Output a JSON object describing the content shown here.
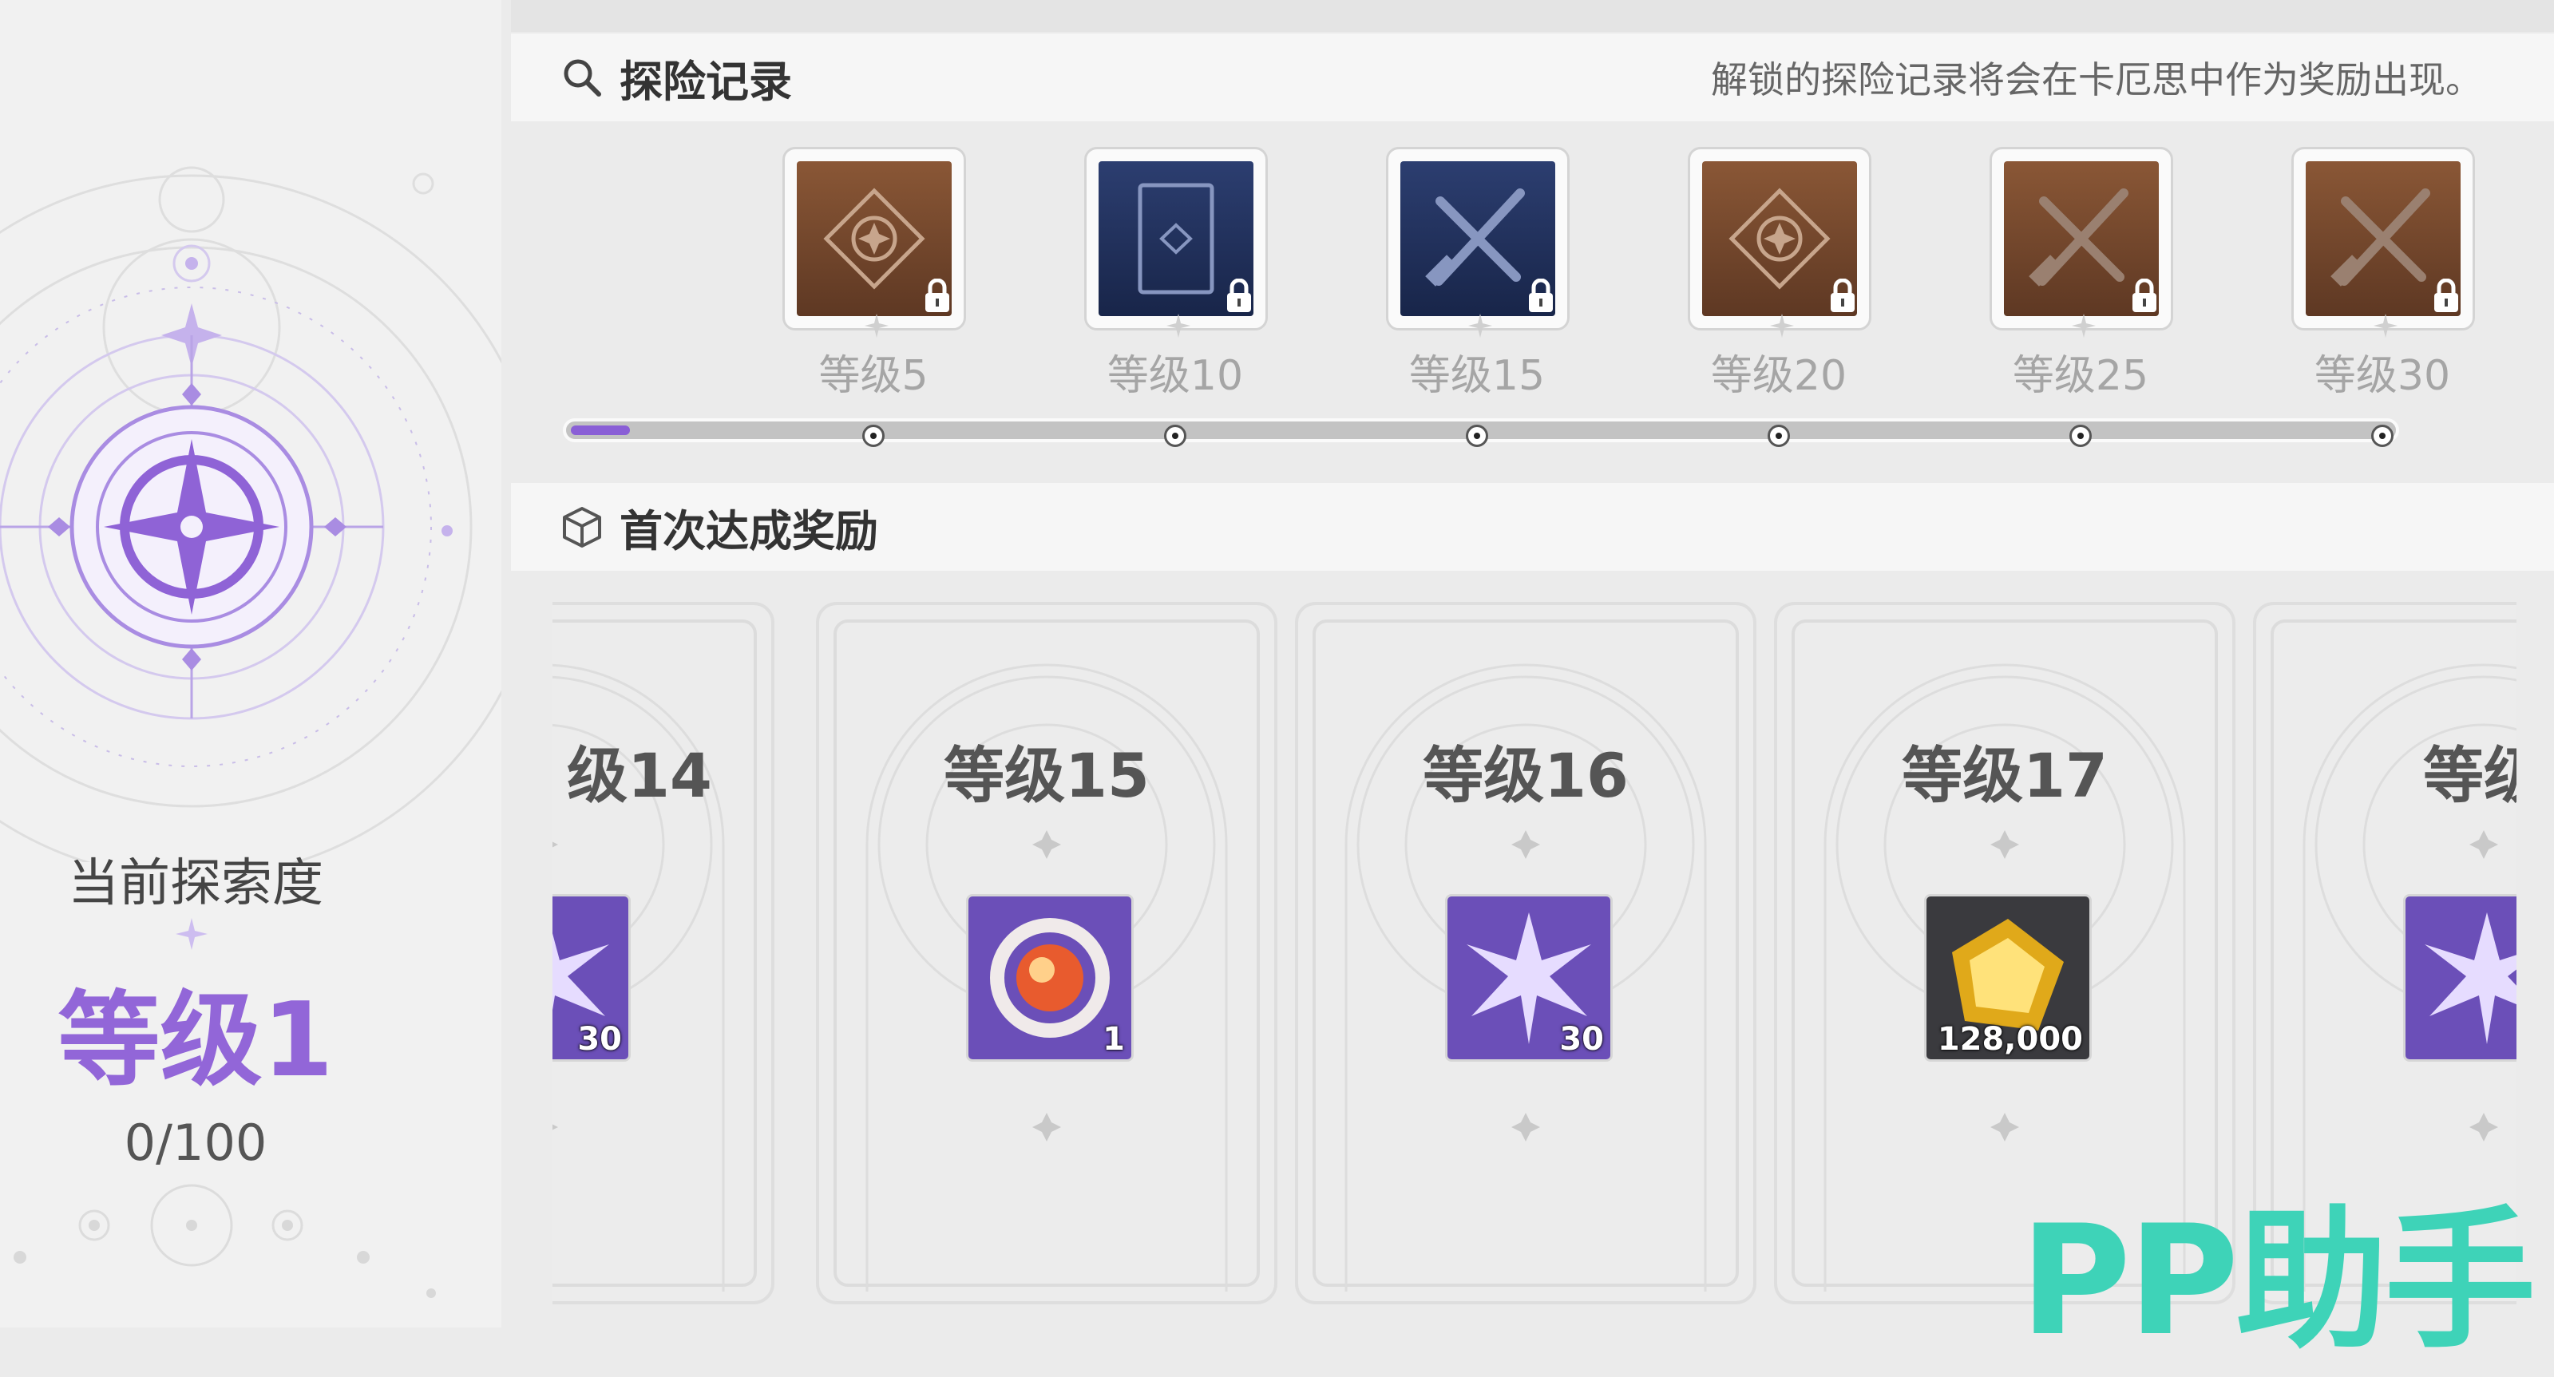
{
  "left_panel": {
    "current_label": "当前探索度",
    "level": "等级1",
    "progress": "0/100"
  },
  "records": {
    "title": "探险记录",
    "hint": "解锁的探险记录将会在卡厄思中作为奖励出现。",
    "items": [
      {
        "level": "等级5",
        "icon": "diamond-target-icon",
        "theme": "brown"
      },
      {
        "level": "等级10",
        "icon": "card-icon",
        "theme": "navy"
      },
      {
        "level": "等级15",
        "icon": "crossed-weapons-icon",
        "theme": "navy"
      },
      {
        "level": "等级20",
        "icon": "diamond-target-icon",
        "theme": "brown"
      },
      {
        "level": "等级25",
        "icon": "crossed-weapons-icon",
        "theme": "brown"
      },
      {
        "level": "等级30",
        "icon": "crossed-weapons-icon",
        "theme": "brown"
      }
    ],
    "progress_fraction": 0.02
  },
  "rewards": {
    "title": "首次达成奖励",
    "cards": [
      {
        "level": "级14",
        "item": "crystal-star-icon",
        "quantity": "30"
      },
      {
        "level": "等级15",
        "item": "orb-device-icon",
        "quantity": "1"
      },
      {
        "level": "等级16",
        "item": "crystal-star-icon",
        "quantity": "30"
      },
      {
        "level": "等级17",
        "item": "gold-cube-icon",
        "quantity": "128,000"
      },
      {
        "level": "等级",
        "item": "crystal-star-icon",
        "quantity": ""
      }
    ]
  },
  "watermark": "PP助手",
  "colors": {
    "accent_purple": "#9266d8",
    "record_brown": "#7a4a2c",
    "record_navy": "#1f2f5c",
    "watermark": "#3ed3b8"
  }
}
